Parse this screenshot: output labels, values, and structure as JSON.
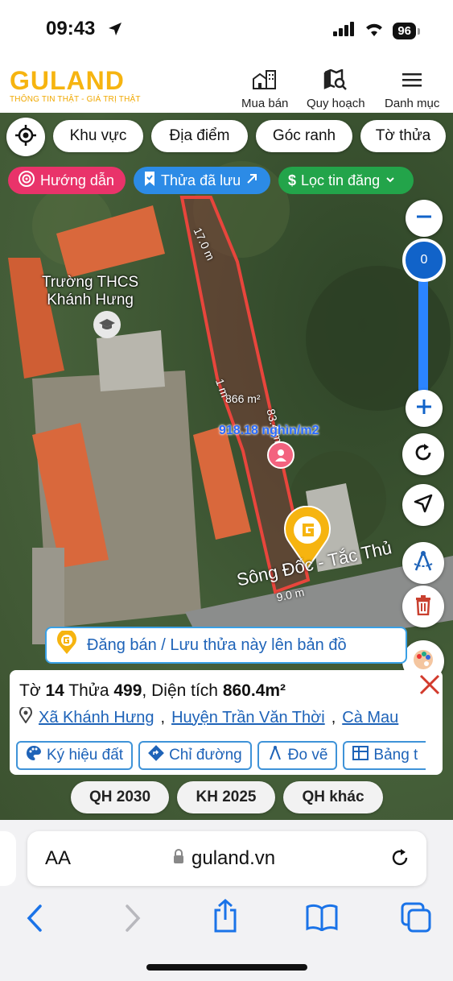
{
  "status_bar": {
    "time": "09:43",
    "battery": "96"
  },
  "header": {
    "logo_text": "GULAND",
    "logo_tagline": "THÔNG TIN THẬT - GIÁ TRỊ THẬT",
    "nav": [
      {
        "label": "Mua bán",
        "icon": "building-icon"
      },
      {
        "label": "Quy hoạch",
        "icon": "map-search-icon"
      },
      {
        "label": "Danh mục",
        "icon": "menu-icon"
      }
    ]
  },
  "filters": [
    "Khu vực",
    "Địa điểm",
    "Góc ranh",
    "Tờ thửa"
  ],
  "chips": {
    "guide": "Hướng dẫn",
    "saved": "Thửa đã lưu",
    "filter": "Lọc tin đăng"
  },
  "map": {
    "school_label_1": "Trường THCS",
    "school_label_2": "Khánh Hưng",
    "edge_top": "17.0 m",
    "edge_left": "1 m",
    "edge_right": "83.4 m",
    "edge_bottom": "9.0 m",
    "area_label": "866 m²",
    "price_label": "918.18 nghìn/m2",
    "river_label": "Sông Đốc - Tắc Thủ",
    "zoom_value": "0",
    "colors": {
      "parcel_border": "#e8453c",
      "brand": "#f6b410",
      "link": "#1e63b8"
    }
  },
  "post_bar": "Đăng bán / Lưu thửa này lên bản đồ",
  "parcel": {
    "sheet_label": "Tờ",
    "sheet": "14",
    "lot_label": "Thửa",
    "lot": "499",
    "area_label": "Diện tích",
    "area": "860.4m²",
    "commune": "Xã Khánh Hưng",
    "district": "Huyện Trần Văn Thời",
    "province": "Cà Mau"
  },
  "tools": [
    "Ký hiệu đất",
    "Chỉ đường",
    "Đo vẽ",
    "Bảng t"
  ],
  "plan_buttons": [
    "QH 2030",
    "KH 2025",
    "QH khác"
  ],
  "browser": {
    "aa": "AA",
    "url": "guland.vn"
  }
}
